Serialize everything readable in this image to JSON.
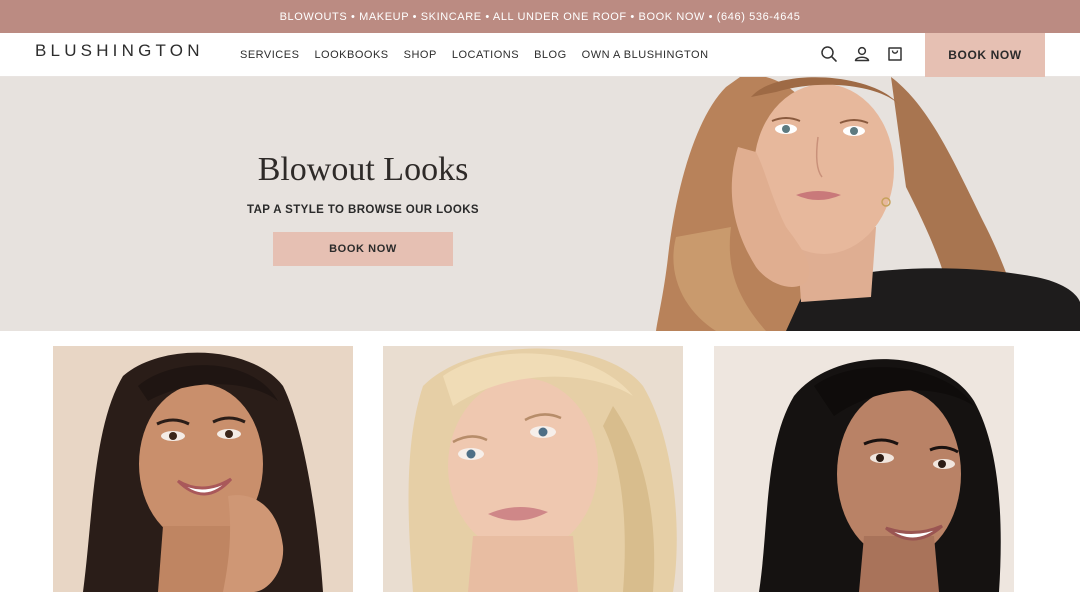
{
  "announcement": {
    "text": "BLOWOUTS • MAKEUP • SKINCARE • ALL UNDER ONE ROOF • BOOK NOW • (646) 536-4645"
  },
  "header": {
    "logo": "BLUSHINGTON",
    "nav": [
      {
        "label": "SERVICES"
      },
      {
        "label": "LOOKBOOKS"
      },
      {
        "label": "SHOP"
      },
      {
        "label": "LOCATIONS"
      },
      {
        "label": "BLOG"
      },
      {
        "label": "OWN A BLUSHINGTON"
      }
    ],
    "icons": [
      "search-icon",
      "account-icon",
      "cart-icon"
    ],
    "book_label": "BOOK NOW"
  },
  "hero": {
    "title": "Blowout Looks",
    "subtitle": "TAP A STYLE TO BROWSE OUR LOOKS",
    "button_label": "BOOK NOW"
  },
  "looks": [
    {
      "hair": "dark brown wavy"
    },
    {
      "hair": "blonde wavy"
    },
    {
      "hair": "black straight"
    }
  ],
  "colors": {
    "announcement_bg": "#bb8b82",
    "accent": "#e6c0b3",
    "hero_bg": "#e7e2de",
    "text": "#2b2b2b"
  }
}
